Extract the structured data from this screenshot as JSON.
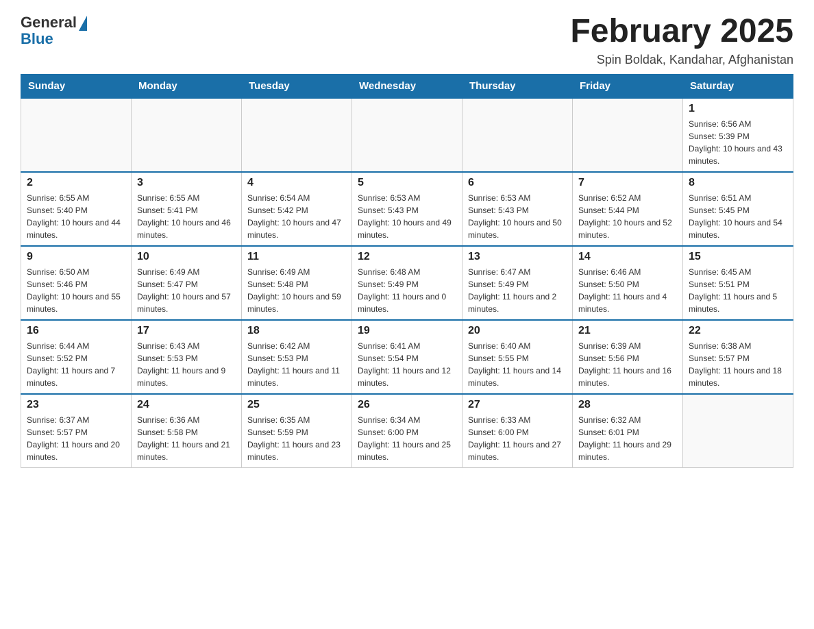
{
  "header": {
    "logo_general": "General",
    "logo_blue": "Blue",
    "month_title": "February 2025",
    "location": "Spin Boldak, Kandahar, Afghanistan"
  },
  "days_of_week": [
    "Sunday",
    "Monday",
    "Tuesday",
    "Wednesday",
    "Thursday",
    "Friday",
    "Saturday"
  ],
  "weeks": [
    {
      "days": [
        {
          "num": "",
          "info": ""
        },
        {
          "num": "",
          "info": ""
        },
        {
          "num": "",
          "info": ""
        },
        {
          "num": "",
          "info": ""
        },
        {
          "num": "",
          "info": ""
        },
        {
          "num": "",
          "info": ""
        },
        {
          "num": "1",
          "info": "Sunrise: 6:56 AM\nSunset: 5:39 PM\nDaylight: 10 hours and 43 minutes."
        }
      ]
    },
    {
      "days": [
        {
          "num": "2",
          "info": "Sunrise: 6:55 AM\nSunset: 5:40 PM\nDaylight: 10 hours and 44 minutes."
        },
        {
          "num": "3",
          "info": "Sunrise: 6:55 AM\nSunset: 5:41 PM\nDaylight: 10 hours and 46 minutes."
        },
        {
          "num": "4",
          "info": "Sunrise: 6:54 AM\nSunset: 5:42 PM\nDaylight: 10 hours and 47 minutes."
        },
        {
          "num": "5",
          "info": "Sunrise: 6:53 AM\nSunset: 5:43 PM\nDaylight: 10 hours and 49 minutes."
        },
        {
          "num": "6",
          "info": "Sunrise: 6:53 AM\nSunset: 5:43 PM\nDaylight: 10 hours and 50 minutes."
        },
        {
          "num": "7",
          "info": "Sunrise: 6:52 AM\nSunset: 5:44 PM\nDaylight: 10 hours and 52 minutes."
        },
        {
          "num": "8",
          "info": "Sunrise: 6:51 AM\nSunset: 5:45 PM\nDaylight: 10 hours and 54 minutes."
        }
      ]
    },
    {
      "days": [
        {
          "num": "9",
          "info": "Sunrise: 6:50 AM\nSunset: 5:46 PM\nDaylight: 10 hours and 55 minutes."
        },
        {
          "num": "10",
          "info": "Sunrise: 6:49 AM\nSunset: 5:47 PM\nDaylight: 10 hours and 57 minutes."
        },
        {
          "num": "11",
          "info": "Sunrise: 6:49 AM\nSunset: 5:48 PM\nDaylight: 10 hours and 59 minutes."
        },
        {
          "num": "12",
          "info": "Sunrise: 6:48 AM\nSunset: 5:49 PM\nDaylight: 11 hours and 0 minutes."
        },
        {
          "num": "13",
          "info": "Sunrise: 6:47 AM\nSunset: 5:49 PM\nDaylight: 11 hours and 2 minutes."
        },
        {
          "num": "14",
          "info": "Sunrise: 6:46 AM\nSunset: 5:50 PM\nDaylight: 11 hours and 4 minutes."
        },
        {
          "num": "15",
          "info": "Sunrise: 6:45 AM\nSunset: 5:51 PM\nDaylight: 11 hours and 5 minutes."
        }
      ]
    },
    {
      "days": [
        {
          "num": "16",
          "info": "Sunrise: 6:44 AM\nSunset: 5:52 PM\nDaylight: 11 hours and 7 minutes."
        },
        {
          "num": "17",
          "info": "Sunrise: 6:43 AM\nSunset: 5:53 PM\nDaylight: 11 hours and 9 minutes."
        },
        {
          "num": "18",
          "info": "Sunrise: 6:42 AM\nSunset: 5:53 PM\nDaylight: 11 hours and 11 minutes."
        },
        {
          "num": "19",
          "info": "Sunrise: 6:41 AM\nSunset: 5:54 PM\nDaylight: 11 hours and 12 minutes."
        },
        {
          "num": "20",
          "info": "Sunrise: 6:40 AM\nSunset: 5:55 PM\nDaylight: 11 hours and 14 minutes."
        },
        {
          "num": "21",
          "info": "Sunrise: 6:39 AM\nSunset: 5:56 PM\nDaylight: 11 hours and 16 minutes."
        },
        {
          "num": "22",
          "info": "Sunrise: 6:38 AM\nSunset: 5:57 PM\nDaylight: 11 hours and 18 minutes."
        }
      ]
    },
    {
      "days": [
        {
          "num": "23",
          "info": "Sunrise: 6:37 AM\nSunset: 5:57 PM\nDaylight: 11 hours and 20 minutes."
        },
        {
          "num": "24",
          "info": "Sunrise: 6:36 AM\nSunset: 5:58 PM\nDaylight: 11 hours and 21 minutes."
        },
        {
          "num": "25",
          "info": "Sunrise: 6:35 AM\nSunset: 5:59 PM\nDaylight: 11 hours and 23 minutes."
        },
        {
          "num": "26",
          "info": "Sunrise: 6:34 AM\nSunset: 6:00 PM\nDaylight: 11 hours and 25 minutes."
        },
        {
          "num": "27",
          "info": "Sunrise: 6:33 AM\nSunset: 6:00 PM\nDaylight: 11 hours and 27 minutes."
        },
        {
          "num": "28",
          "info": "Sunrise: 6:32 AM\nSunset: 6:01 PM\nDaylight: 11 hours and 29 minutes."
        },
        {
          "num": "",
          "info": ""
        }
      ]
    }
  ]
}
